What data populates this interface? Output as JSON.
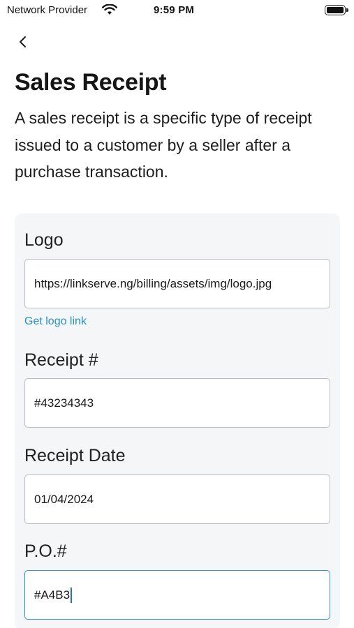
{
  "status_bar": {
    "carrier": "Network Provider",
    "time": "9:59 PM"
  },
  "header": {
    "title": "Sales Receipt",
    "description": "A sales receipt is a specific type of receipt issued to a customer by a seller after a purchase transaction."
  },
  "form": {
    "logo": {
      "label": "Logo",
      "value": "https://linkserve.ng/billing/assets/img/logo.jpg",
      "link": "Get logo link"
    },
    "receipt_number": {
      "label": "Receipt #",
      "value": "#43234343"
    },
    "receipt_date": {
      "label": "Receipt Date",
      "value": "01/04/2024"
    },
    "po_number": {
      "label": "P.O.#",
      "value": "#A4B3"
    }
  },
  "colors": {
    "link": "#2c8fc6",
    "focus_border": "#2f8fd0",
    "card_background": "#f5f6f8"
  }
}
